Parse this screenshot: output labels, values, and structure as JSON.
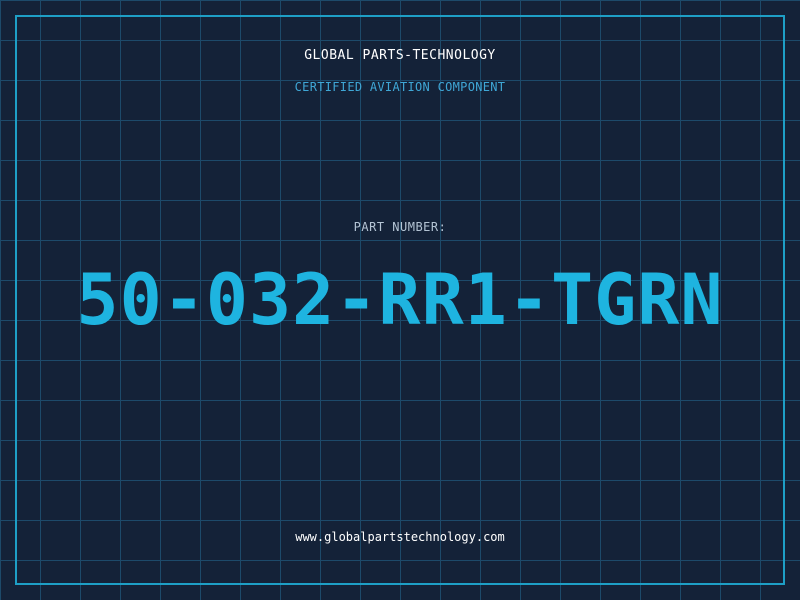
{
  "header": {
    "company_name": "GLOBAL PARTS-TECHNOLOGY",
    "subtitle": "CERTIFIED AVIATION COMPONENT"
  },
  "part": {
    "label": "PART NUMBER:",
    "number": "50-032-RR1-TGRN"
  },
  "footer": {
    "url": "www.globalpartstechnology.com"
  },
  "colors": {
    "background": "#142238",
    "grid": "#1d4a6a",
    "frame": "#1e9fc6",
    "accent": "#1eb4e0"
  }
}
